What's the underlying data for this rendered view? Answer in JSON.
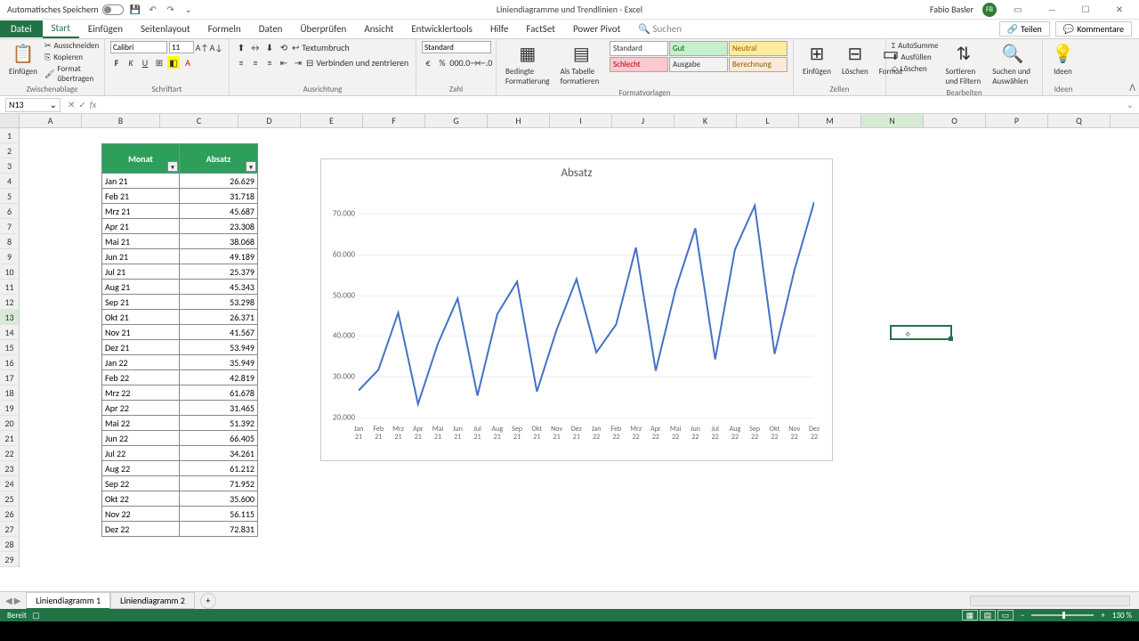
{
  "titlebar": {
    "autosave": "Automatisches Speichern",
    "doc_title": "Liniendiagramme und Trendlinien  -  Excel",
    "user": "Fabio Basler",
    "user_initials": "FB"
  },
  "ribbon": {
    "file": "Datei",
    "tabs": [
      "Start",
      "Einfügen",
      "Seitenlayout",
      "Formeln",
      "Daten",
      "Überprüfen",
      "Ansicht",
      "Entwicklertools",
      "Hilfe",
      "FactSet",
      "Power Pivot"
    ],
    "search": "Suchen",
    "share": "Teilen",
    "comments": "Kommentare",
    "clipboard": {
      "label": "Zwischenablage",
      "paste": "Einfügen",
      "cut": "Ausschneiden",
      "copy": "Kopieren",
      "format": "Format übertragen"
    },
    "font": {
      "label": "Schriftart",
      "name": "Calibri",
      "size": "11"
    },
    "align": {
      "label": "Ausrichtung",
      "wrap": "Textumbruch",
      "merge": "Verbinden und zentrieren"
    },
    "number": {
      "label": "Zahl",
      "format": "Standard"
    },
    "styles": {
      "label": "Formatvorlagen",
      "cond": "Bedingte Formatierung",
      "table": "Als Tabelle formatieren",
      "standard": "Standard",
      "schlecht": "Schlecht",
      "gut": "Gut",
      "ausgabe": "Ausgabe",
      "neutral": "Neutral",
      "berechnung": "Berechnung"
    },
    "cells": {
      "label": "Zellen",
      "insert": "Einfügen",
      "delete": "Löschen",
      "format": "Format"
    },
    "editing": {
      "label": "Bearbeiten",
      "sum": "AutoSumme",
      "fill": "Ausfüllen",
      "clear": "Löschen",
      "sort": "Sortieren und Filtern",
      "find": "Suchen und Auswählen"
    },
    "ideas": {
      "label": "Ideen",
      "btn": "Ideen"
    }
  },
  "namebox": "N13",
  "columns": [
    "A",
    "B",
    "C",
    "D",
    "E",
    "F",
    "G",
    "H",
    "I",
    "J",
    "K",
    "L",
    "M",
    "N",
    "O",
    "P",
    "Q"
  ],
  "table": {
    "headers": {
      "monat": "Monat",
      "absatz": "Absatz"
    },
    "rows": [
      {
        "m": "Jan 21",
        "v": "26.629"
      },
      {
        "m": "Feb 21",
        "v": "31.718"
      },
      {
        "m": "Mrz 21",
        "v": "45.687"
      },
      {
        "m": "Apr 21",
        "v": "23.308"
      },
      {
        "m": "Mai 21",
        "v": "38.068"
      },
      {
        "m": "Jun 21",
        "v": "49.189"
      },
      {
        "m": "Jul 21",
        "v": "25.379"
      },
      {
        "m": "Aug 21",
        "v": "45.343"
      },
      {
        "m": "Sep 21",
        "v": "53.298"
      },
      {
        "m": "Okt 21",
        "v": "26.371"
      },
      {
        "m": "Nov 21",
        "v": "41.567"
      },
      {
        "m": "Dez 21",
        "v": "53.949"
      },
      {
        "m": "Jan 22",
        "v": "35.949"
      },
      {
        "m": "Feb 22",
        "v": "42.819"
      },
      {
        "m": "Mrz 22",
        "v": "61.678"
      },
      {
        "m": "Apr 22",
        "v": "31.465"
      },
      {
        "m": "Mai 22",
        "v": "51.392"
      },
      {
        "m": "Jun 22",
        "v": "66.405"
      },
      {
        "m": "Jul 22",
        "v": "34.261"
      },
      {
        "m": "Aug 22",
        "v": "61.212"
      },
      {
        "m": "Sep 22",
        "v": "71.952"
      },
      {
        "m": "Okt 22",
        "v": "35.600"
      },
      {
        "m": "Nov 22",
        "v": "56.115"
      },
      {
        "m": "Dez 22",
        "v": "72.831"
      }
    ]
  },
  "chart_data": {
    "type": "line",
    "title": "Absatz",
    "xlabel": "",
    "ylabel": "",
    "ylim": [
      20000,
      75000
    ],
    "yticks": [
      20000,
      30000,
      40000,
      50000,
      60000,
      70000
    ],
    "ytick_labels": [
      "20.000",
      "30.000",
      "40.000",
      "50.000",
      "60.000",
      "70.000"
    ],
    "categories": [
      "Jan 21",
      "Feb 21",
      "Mrz 21",
      "Apr 21",
      "Mai 21",
      "Jun 21",
      "Jul 21",
      "Aug 21",
      "Sep 21",
      "Okt 21",
      "Nov 21",
      "Dez 21",
      "Jan 22",
      "Feb 22",
      "Mrz 22",
      "Apr 22",
      "Mai 22",
      "Jun 22",
      "Jul 22",
      "Aug 22",
      "Sep 22",
      "Okt 22",
      "Nov 22",
      "Dez 22"
    ],
    "values": [
      26629,
      31718,
      45687,
      23308,
      38068,
      49189,
      25379,
      45343,
      53298,
      26371,
      41567,
      53949,
      35949,
      42819,
      61678,
      31465,
      51392,
      66405,
      34261,
      61212,
      71952,
      35600,
      56115,
      72831
    ]
  },
  "sheets": {
    "active": "Liniendiagramm 1",
    "other": "Liniendiagramm 2"
  },
  "status": {
    "ready": "Bereit",
    "zoom": "130 %"
  }
}
